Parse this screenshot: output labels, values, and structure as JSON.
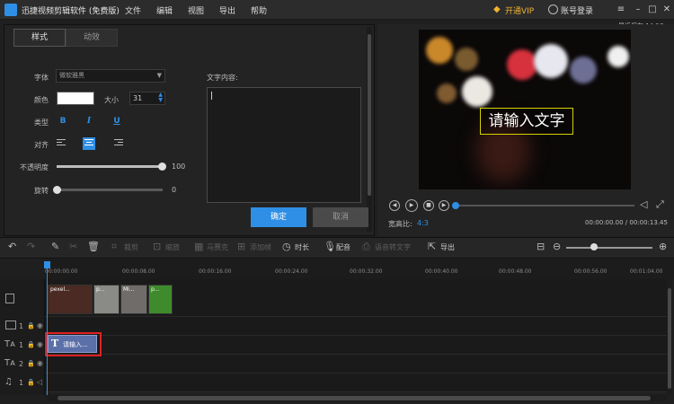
{
  "app": {
    "title": "迅捷视频剪辑软件 (免费版)",
    "menu": [
      "文件",
      "编辑",
      "视图",
      "导出",
      "帮助"
    ],
    "vip_label": "开通VIP",
    "login_label": "账号登录",
    "last_saved": "最近保存 14:18",
    "icons": {
      "logo": "scissors-logo-icon",
      "vip": "diamond-icon",
      "user": "user-icon"
    }
  },
  "text_panel": {
    "tabs": [
      "样式",
      "动效"
    ],
    "font_label": "字体",
    "font_value": "微软雅黑",
    "color_label": "颜色",
    "color_value": "#ffffff",
    "size_label": "大小",
    "size_value": "31",
    "type_label": "类型",
    "type_buttons": [
      "B",
      "I",
      "U"
    ],
    "align_label": "对齐",
    "opacity_label": "不透明度",
    "opacity_value": "100",
    "rotate_label": "旋转",
    "rotate_value": "0",
    "content_label": "文字内容:",
    "content_value": "",
    "ok_label": "确定",
    "cancel_label": "取消",
    "accent_color": "#2f8fe6"
  },
  "preview": {
    "overlay_text": "请输入文字",
    "ratio_label": "宽高比:",
    "ratio_value": "4:3",
    "time_readout": "00:00:00.00 / 00:00:13.45",
    "progress_fraction": 0.0,
    "overlay_border_color": "#d8d200"
  },
  "toolbar": {
    "items": [
      "裁剪",
      "缩放",
      "马赛克",
      "添加帧",
      "时长",
      "配音",
      "语音转文字",
      "导出"
    ],
    "enabled": [
      false,
      false,
      false,
      false,
      true,
      true,
      false,
      true
    ],
    "icons": [
      "undo-icon",
      "redo-icon",
      "edit-icon",
      "cut-icon",
      "delete-icon",
      "crop-icon",
      "zoom-icon",
      "mosaic-icon",
      "freeze-frame-icon",
      "clock-icon",
      "microphone-icon",
      "speech-to-text-icon",
      "export-icon",
      "fit-icon",
      "zoom-out-icon",
      "zoom-in-icon"
    ],
    "zoom_fraction": 0.3
  },
  "timeline": {
    "ticks": [
      "00:00:00.00",
      "00:00:08.00",
      "00:00:16.00",
      "00:00:24.00",
      "00:00:32.00",
      "00:00:40.00",
      "00:00:48.00",
      "00:00:56.00",
      "00:01:04.00"
    ],
    "tracks": [
      {
        "type": "video",
        "index": ""
      },
      {
        "type": "overlay",
        "index": "1"
      },
      {
        "type": "text",
        "index": "1"
      },
      {
        "type": "text",
        "index": "2"
      },
      {
        "type": "music",
        "index": "1"
      }
    ],
    "video_clips": [
      "pexel...",
      "p...",
      "Mi...",
      "p..."
    ],
    "text_clip": "请输入...",
    "highlight_color": "#e02020"
  }
}
